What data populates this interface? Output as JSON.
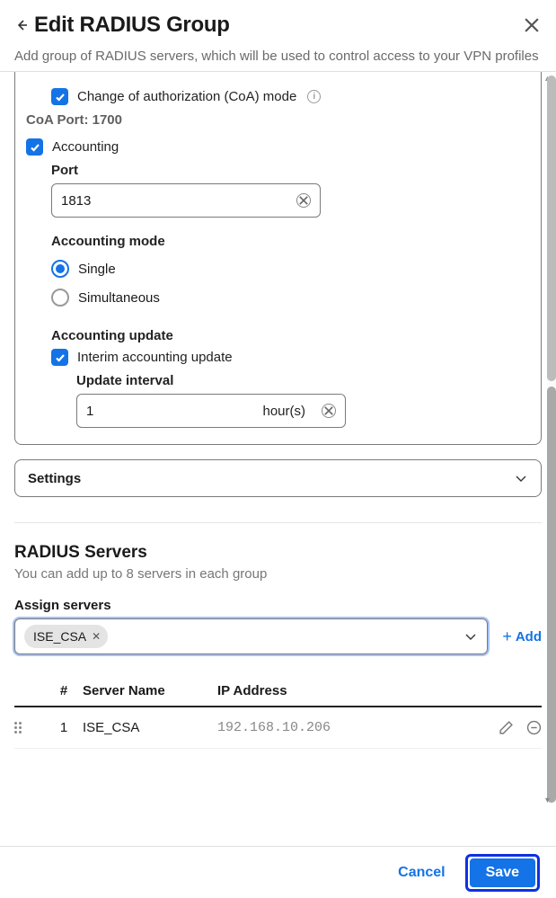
{
  "header": {
    "title": "Edit RADIUS Group",
    "subtitle": "Add group of RADIUS servers, which will be used to control access to your VPN profiles"
  },
  "form": {
    "coa": {
      "label": "Change of authorization (CoA) mode",
      "port_label": "CoA Port: 1700"
    },
    "accounting": {
      "label": "Accounting",
      "port_label": "Port",
      "port_value": "1813",
      "mode_label": "Accounting mode",
      "mode_options": {
        "single": "Single",
        "simultaneous": "Simultaneous"
      },
      "update_label": "Accounting update",
      "interim_label": "Interim accounting update",
      "interval_label": "Update interval",
      "interval_value": "1",
      "interval_unit": "hour(s)"
    },
    "settings_label": "Settings"
  },
  "servers": {
    "heading": "RADIUS Servers",
    "sub": "You can add up to 8 servers in each group",
    "assign_label": "Assign servers",
    "chip": "ISE_CSA",
    "add_label": "Add",
    "cols": {
      "num": "#",
      "name": "Server Name",
      "ip": "IP Address"
    },
    "rows": [
      {
        "num": "1",
        "name": "ISE_CSA",
        "ip": "192.168.10.206"
      }
    ]
  },
  "footer": {
    "cancel": "Cancel",
    "save": "Save"
  }
}
